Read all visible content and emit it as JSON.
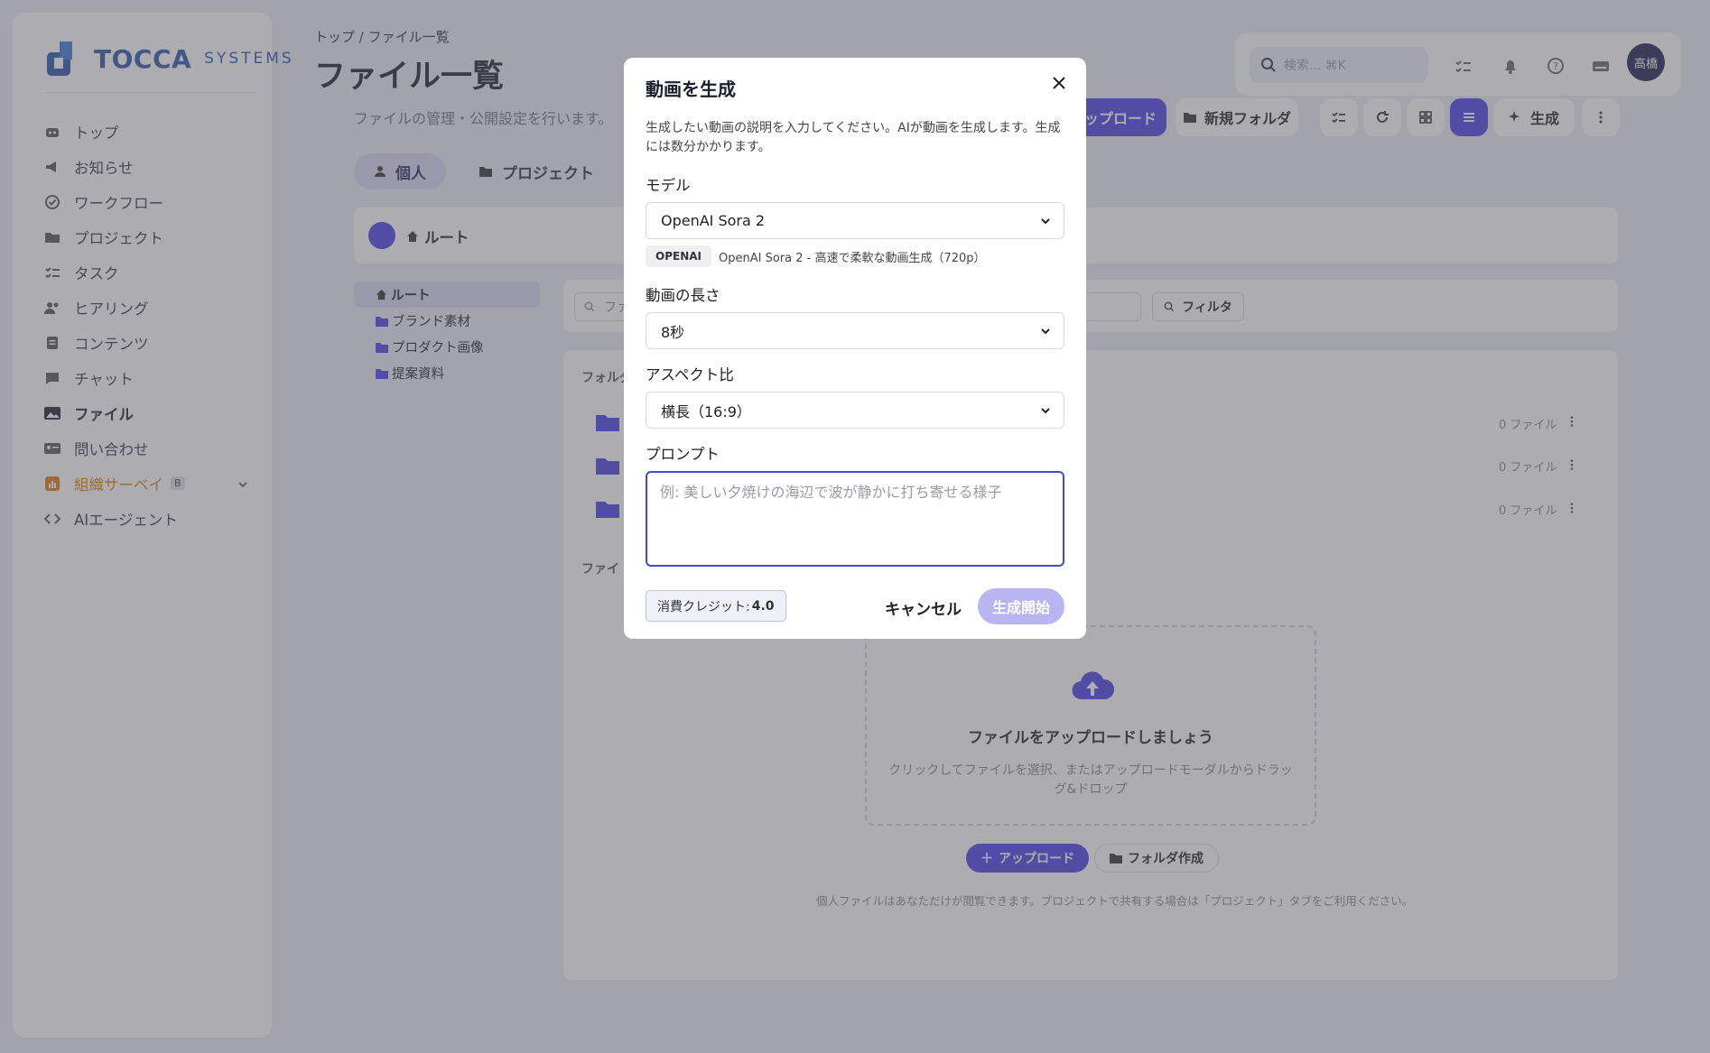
{
  "brand": {
    "name": "TOCCA",
    "sub": "SYSTEMS"
  },
  "sidebar": {
    "items": [
      {
        "label": "トップ",
        "icon": "robot-icon"
      },
      {
        "label": "お知らせ",
        "icon": "megaphone-icon"
      },
      {
        "label": "ワークフロー",
        "icon": "check-circle-icon"
      },
      {
        "label": "プロジェクト",
        "icon": "folder-icon"
      },
      {
        "label": "タスク",
        "icon": "checklist-icon"
      },
      {
        "label": "ヒアリング",
        "icon": "people-icon"
      },
      {
        "label": "コンテンツ",
        "icon": "document-icon"
      },
      {
        "label": "チャット",
        "icon": "chat-icon"
      },
      {
        "label": "ファイル",
        "icon": "image-icon"
      },
      {
        "label": "問い合わせ",
        "icon": "contact-card-icon"
      },
      {
        "label": "組織サーベイ",
        "icon": "chart-icon",
        "badge": "B"
      },
      {
        "label": "AIエージェント",
        "icon": "code-icon"
      }
    ]
  },
  "header": {
    "breadcrumb": "トップ  /  ファイル一覧",
    "title": "ファイル一覧",
    "subtitle": "ファイルの管理・公開設定を行います。",
    "search_placeholder": "検索... ⌘K",
    "avatar": "高橋",
    "upload_label": "ップロード",
    "new_folder_label": "新規フォルダ",
    "generate_label": "生成"
  },
  "tabs": [
    {
      "label": "個人",
      "active": true
    },
    {
      "label": "プロジェクト",
      "active": false
    }
  ],
  "root_label": "ルート",
  "tree": [
    {
      "label": "ルート",
      "active": true
    },
    {
      "label": "ブランド素材"
    },
    {
      "label": "プロダクト画像"
    },
    {
      "label": "提案資料"
    }
  ],
  "filter": {
    "search_text": "ファ",
    "filter_label": "フィルタ"
  },
  "folders": {
    "section_label": "フォルダ",
    "items": [
      {
        "count": "0 ファイル"
      },
      {
        "count": "0 ファイル"
      },
      {
        "count": "0 ファイル"
      }
    ],
    "files_section_label": "ファイ"
  },
  "empty": {
    "title": "ファイルをアップロードしましょう",
    "subtitle": "クリックしてファイルを選択、またはアップロードモーダルからドラッグ&ドロップ",
    "upload_label": "アップロード",
    "folder_label": "フォルダ作成",
    "note": "個人ファイルはあなただけが閲覧できます。プロジェクトで共有する場合は「プロジェクト」タブをご利用ください。"
  },
  "modal": {
    "title": "動画を生成",
    "description": "生成したい動画の説明を入力してください。AIが動画を生成します。生成には数分かかります。",
    "model_label": "モデル",
    "model_value": "OpenAI Sora 2",
    "provider_badge": "OPENAI",
    "provider_desc": "OpenAI Sora 2 - 高速で柔軟な動画生成（720p）",
    "length_label": "動画の長さ",
    "length_value": "8秒",
    "aspect_label": "アスペクト比",
    "aspect_value": "横長（16:9）",
    "prompt_label": "プロンプト",
    "prompt_placeholder": "例: 美しい夕焼けの海辺で波が静かに打ち寄せる様子",
    "credit_label": "消費クレジット:",
    "credit_value": "4.0",
    "cancel_label": "キャンセル",
    "generate_label": "生成開始"
  },
  "colors": {
    "accent": "#4a3fe6",
    "brand": "#2a54a8",
    "survey": "#e07a14"
  }
}
